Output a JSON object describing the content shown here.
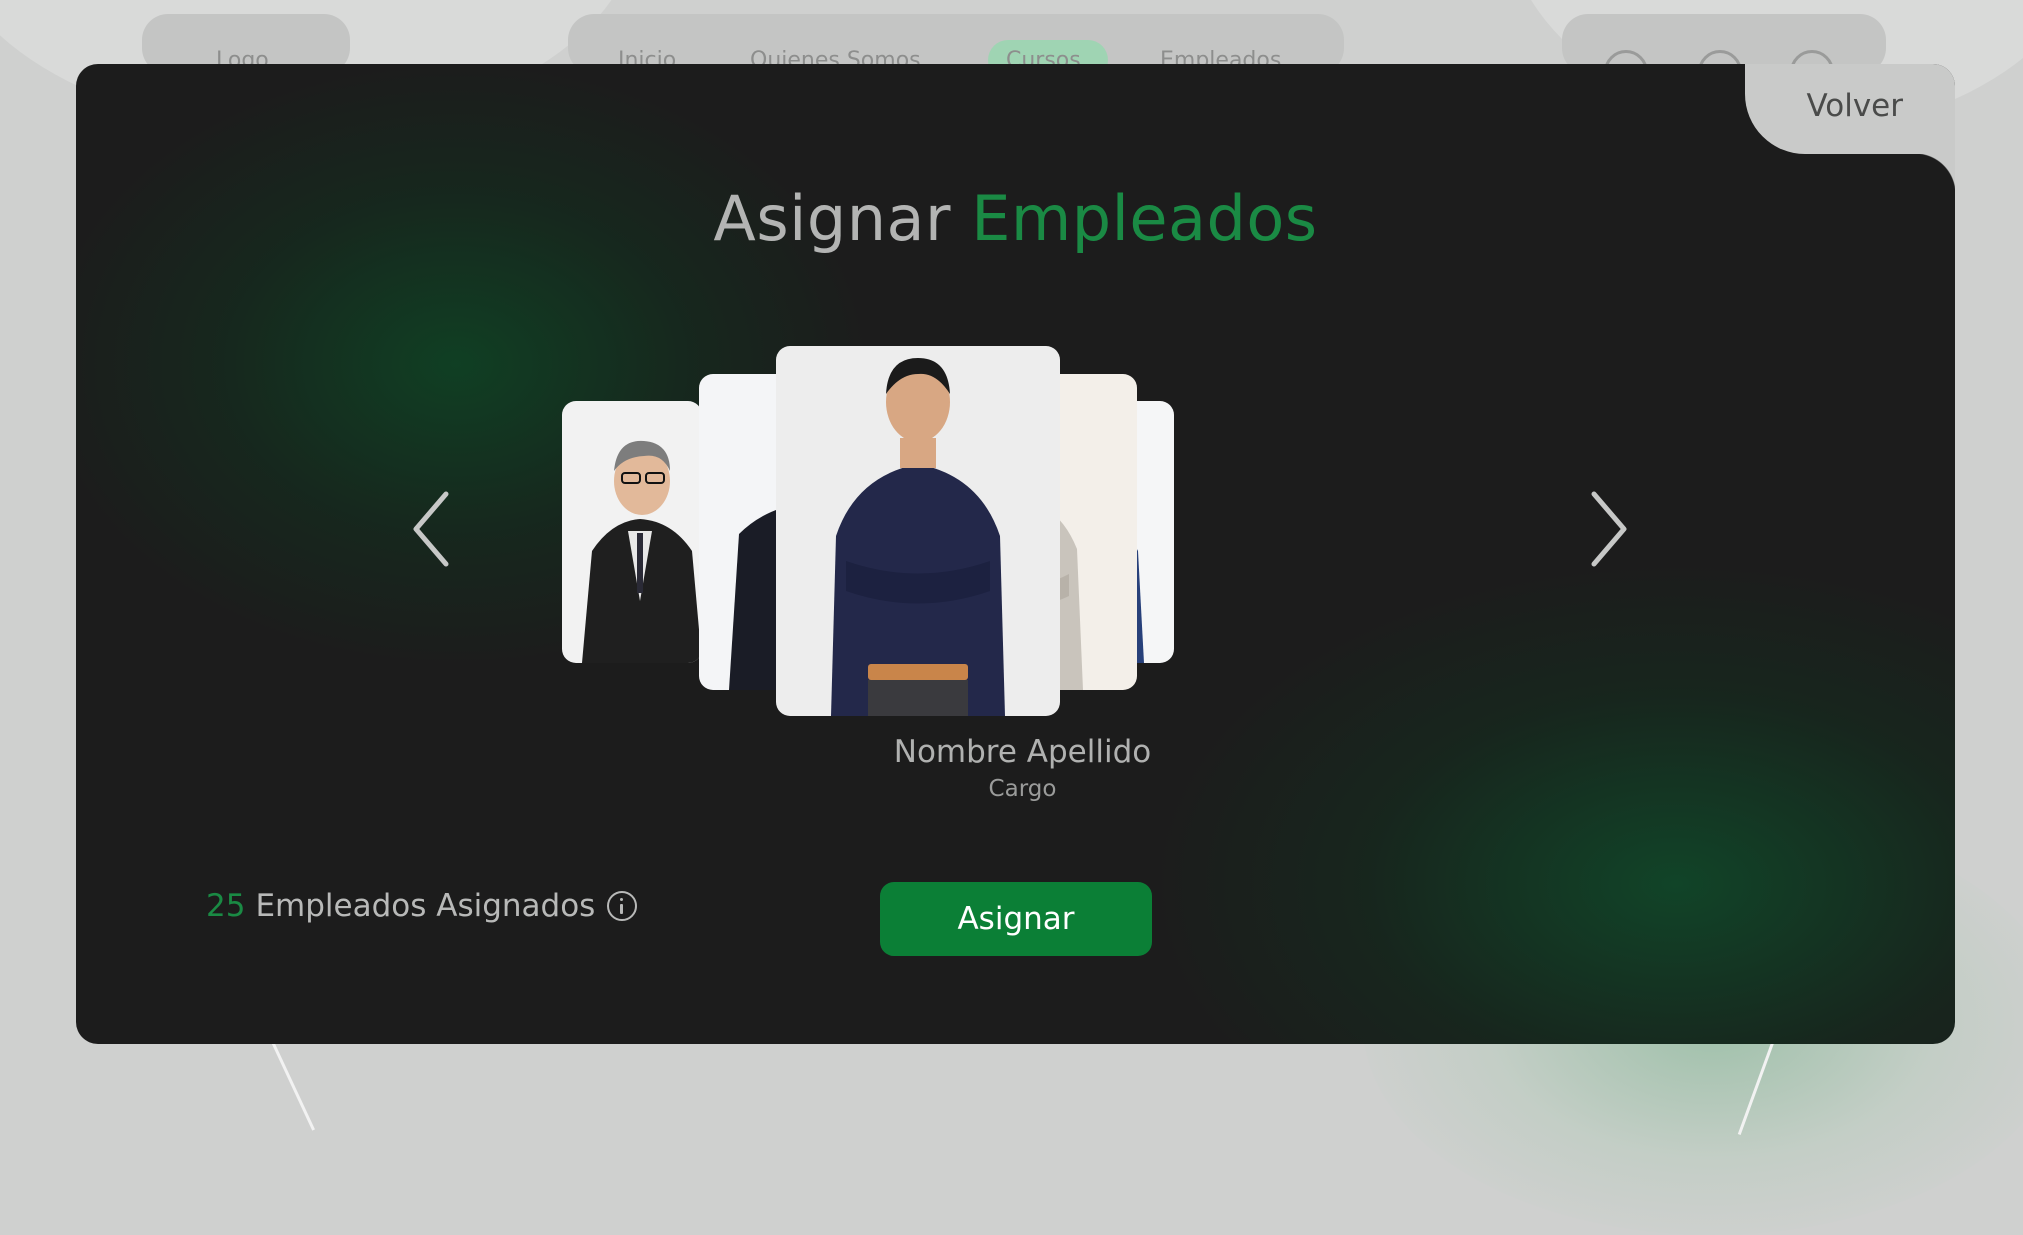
{
  "nav": {
    "logo": "Logo",
    "items": [
      "Inicio",
      "Quienes Somos",
      "Cursos",
      "Empleados"
    ],
    "active_item": "Cursos",
    "icons": [
      "gear-icon",
      "bell-icon",
      "user-icon"
    ]
  },
  "modal": {
    "back_label": "Volver",
    "title_part1": "Asignar",
    "title_part2": "Empleados",
    "employee_name": "Nombre Apellido",
    "employee_role": "Cargo",
    "assigned_count": "25",
    "assigned_label": "Empleados Asignados",
    "assign_button": "Asignar",
    "prev_icon": "chevron-left-icon",
    "next_icon": "chevron-right-icon",
    "info_icon": "info-icon"
  },
  "colors": {
    "accent": "#1a8a44",
    "button": "#0b7f36",
    "modal_bg": "#1c1c1c"
  },
  "carousel": {
    "cards": [
      {
        "alt": "Employee photo - man in suit with glasses"
      },
      {
        "alt": "Employee photo - man in navy suit with glasses"
      },
      {
        "alt": "Employee photo - man in navy shirt"
      },
      {
        "alt": "Employee photo - woman in beige blazer"
      },
      {
        "alt": "Employee photo - woman in blue blazer"
      }
    ]
  }
}
